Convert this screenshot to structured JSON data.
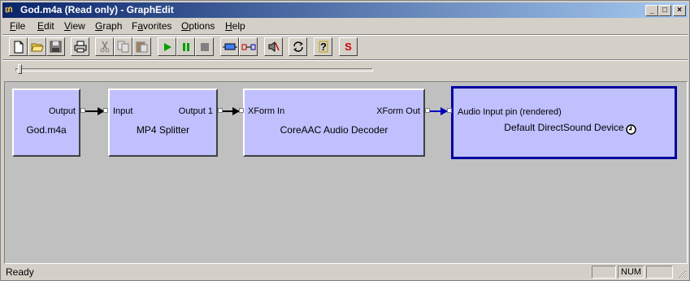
{
  "window": {
    "title": "God.m4a (Read only) - GraphEdit",
    "title_icon": "graphedit-icon",
    "controls": [
      "_",
      "□",
      "×"
    ]
  },
  "menu": {
    "items": [
      {
        "label": "File",
        "accel": "F",
        "rest": "ile"
      },
      {
        "label": "Edit",
        "accel": "E",
        "rest": "dit"
      },
      {
        "label": "View",
        "accel": "V",
        "rest": "iew"
      },
      {
        "label": "Graph",
        "accel": "G",
        "rest": "raph"
      },
      {
        "label": "Favorites",
        "accel": "a",
        "pre": "F",
        "rest": "vorites"
      },
      {
        "label": "Options",
        "accel": "O",
        "rest": "ptions"
      },
      {
        "label": "Help",
        "accel": "H",
        "rest": "elp"
      }
    ]
  },
  "toolbar": {
    "buttons": [
      "new-icon",
      "open-icon",
      "save-icon",
      "print-icon",
      "cut-icon",
      "copy-icon",
      "paste-icon",
      "play-icon",
      "pause-icon",
      "stop-icon",
      "seek-bar-icon",
      "filter-connect-icon",
      "mute-icon",
      "refresh-icon",
      "help-icon",
      "sync-icon"
    ],
    "sync_label": "S"
  },
  "seek": {
    "position_fraction": 0.0
  },
  "graph": {
    "filters": [
      {
        "name": "God.m4a",
        "pins_out": [
          "Output"
        ],
        "pins_in": []
      },
      {
        "name": "MP4 Splitter",
        "pins_in": [
          "Input"
        ],
        "pins_out": [
          "Output 1"
        ]
      },
      {
        "name": "CoreAAC Audio Decoder",
        "pins_in": [
          "XForm In"
        ],
        "pins_out": [
          "XForm Out"
        ]
      },
      {
        "name": "Default DirectSound Device",
        "pins_in": [
          "Audio Input pin (rendered)"
        ],
        "pins_out": [],
        "clock_icon": "clock-icon"
      }
    ]
  },
  "status": {
    "text": "Ready",
    "num": "NUM",
    "caps": "",
    "scroll": ""
  },
  "colors": {
    "title_start": "#0a246a",
    "title_end": "#a6caf0",
    "filter_fill": "#c0c0ff",
    "selected_border": "#0000a0",
    "connection": "#000000",
    "selected_connection": "#0000c0"
  }
}
